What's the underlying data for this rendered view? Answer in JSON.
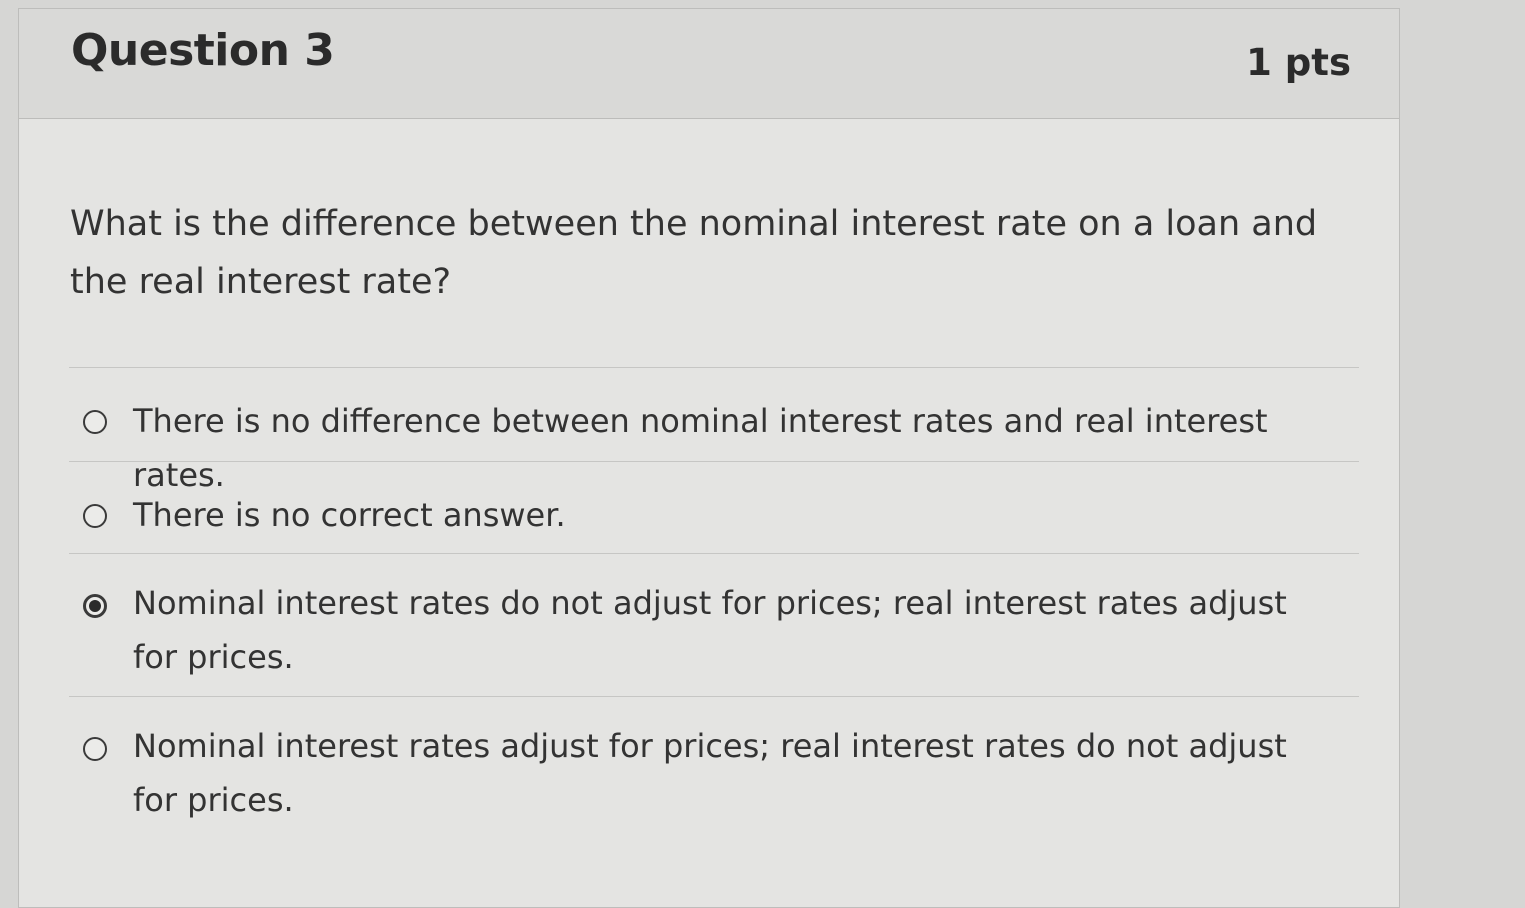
{
  "question": {
    "title": "Question 3",
    "points": "1 pts",
    "text": "What is the difference between the nominal interest rate on a loan and the real interest rate?"
  },
  "answers": [
    {
      "label": "There is no difference between nominal interest rates and real interest rates.",
      "selected": false
    },
    {
      "label": "There is no correct answer.",
      "selected": false
    },
    {
      "label": "Nominal interest rates do not adjust for prices; real interest rates adjust for prices.",
      "selected": true
    },
    {
      "label": "Nominal interest rates adjust for prices; real interest rates do not adjust for prices.",
      "selected": false
    }
  ]
}
